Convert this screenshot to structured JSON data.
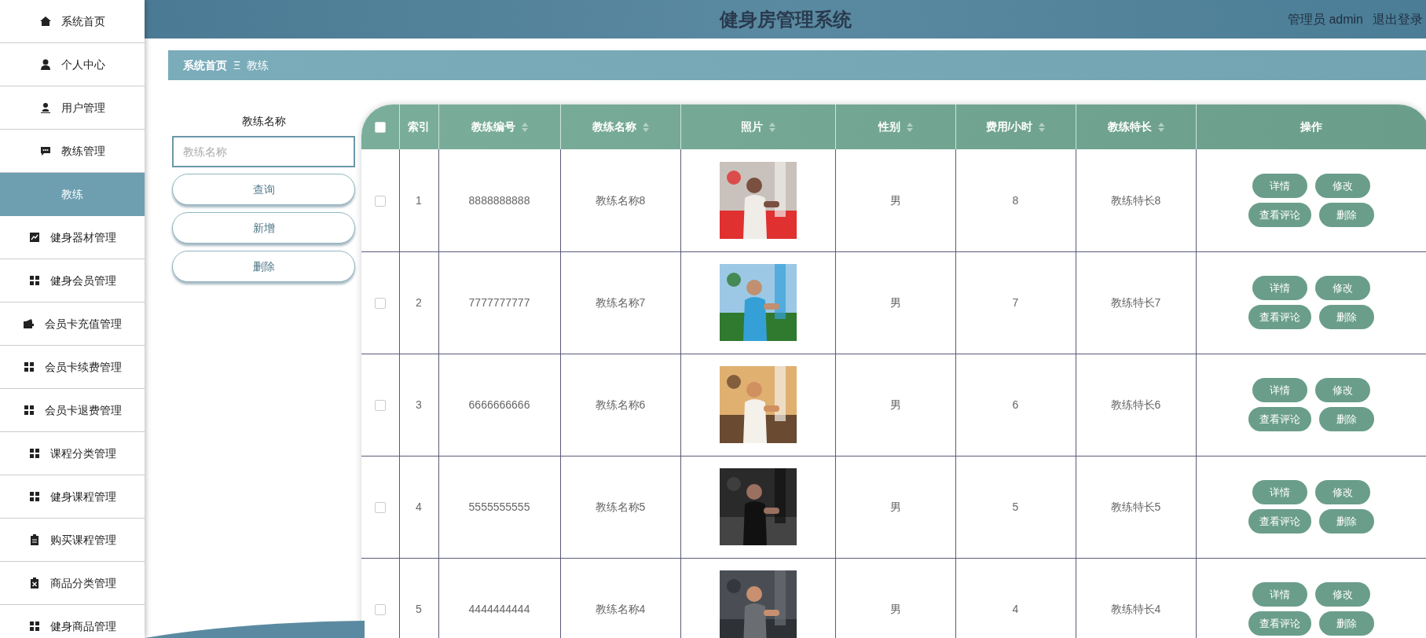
{
  "sidebar": {
    "items": [
      {
        "label": "系统首页",
        "kind": "home",
        "selected": false
      },
      {
        "label": "个人中心",
        "kind": "person",
        "selected": false
      },
      {
        "label": "用户管理",
        "kind": "user",
        "selected": false
      },
      {
        "label": "教练管理",
        "kind": "chat",
        "selected": false
      },
      {
        "label": "教练",
        "kind": "sub",
        "selected": true
      },
      {
        "label": "健身器材管理",
        "kind": "chart",
        "selected": false
      },
      {
        "label": "健身会员管理",
        "kind": "grid",
        "selected": false
      },
      {
        "label": "会员卡充值管理",
        "kind": "wallet",
        "selected": false
      },
      {
        "label": "会员卡续费管理",
        "kind": "grid",
        "selected": false
      },
      {
        "label": "会员卡退费管理",
        "kind": "grid",
        "selected": false
      },
      {
        "label": "课程分类管理",
        "kind": "grid",
        "selected": false
      },
      {
        "label": "健身课程管理",
        "kind": "grid",
        "selected": false
      },
      {
        "label": "购买课程管理",
        "kind": "clipboard",
        "selected": false
      },
      {
        "label": "商品分类管理",
        "kind": "clipboard-x",
        "selected": false
      },
      {
        "label": "健身商品管理",
        "kind": "grid",
        "selected": false
      }
    ]
  },
  "header": {
    "title": "健身房管理系统",
    "user": "管理员 admin",
    "logout": "退出登录"
  },
  "breadcrumb": {
    "items": [
      "系统首页",
      "教练"
    ],
    "separator": "Ξ"
  },
  "search": {
    "label": "教练名称",
    "placeholder": "教练名称",
    "buttons": [
      "查询",
      "新增",
      "删除"
    ]
  },
  "table": {
    "select_all": {
      "checked": false
    },
    "columns": [
      {
        "label": "索引",
        "sortable": false
      },
      {
        "label": "教练编号",
        "sortable": true
      },
      {
        "label": "教练名称",
        "sortable": true
      },
      {
        "label": "照片",
        "sortable": true
      },
      {
        "label": "性别",
        "sortable": true
      },
      {
        "label": "费用/小时",
        "sortable": true
      },
      {
        "label": "教练特长",
        "sortable": true
      },
      {
        "label": "操作",
        "sortable": false
      }
    ],
    "rows": [
      {
        "checked": false,
        "index": "1",
        "id": "8888888888",
        "name": "教练名称8",
        "photo": {
          "kind": "picture"
        },
        "gender": "男",
        "fee": "8",
        "specialty": "教练特长8",
        "actions": [
          "详情",
          "修改",
          "查看评论",
          "删除"
        ]
      },
      {
        "checked": false,
        "index": "2",
        "id": "7777777777",
        "name": "教练名称7",
        "photo": {
          "kind": "picture"
        },
        "gender": "男",
        "fee": "7",
        "specialty": "教练特长7",
        "actions": [
          "详情",
          "修改",
          "查看评论",
          "删除"
        ]
      },
      {
        "checked": false,
        "index": "3",
        "id": "6666666666",
        "name": "教练名称6",
        "photo": {
          "kind": "picture"
        },
        "gender": "男",
        "fee": "6",
        "specialty": "教练特长6",
        "actions": [
          "详情",
          "修改",
          "查看评论",
          "删除"
        ]
      },
      {
        "checked": false,
        "index": "4",
        "id": "5555555555",
        "name": "教练名称5",
        "photo": {
          "kind": "picture"
        },
        "gender": "男",
        "fee": "5",
        "specialty": "教练特长5",
        "actions": [
          "详情",
          "修改",
          "查看评论",
          "删除"
        ]
      },
      {
        "checked": false,
        "index": "5",
        "id": "4444444444",
        "name": "教练名称4",
        "photo": {
          "kind": "picture"
        },
        "gender": "男",
        "fee": "4",
        "specialty": "教练特长4",
        "actions": [
          "详情",
          "修改",
          "查看评论",
          "删除"
        ]
      }
    ]
  }
}
